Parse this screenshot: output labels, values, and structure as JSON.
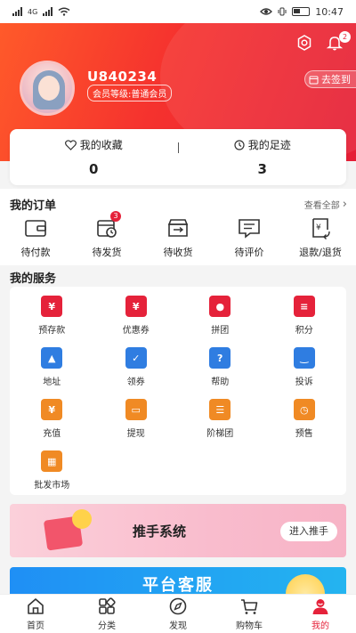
{
  "status_bar": {
    "network": "4G",
    "time": "10:47"
  },
  "header": {
    "username": "U840234",
    "member_level": "会员等级:普通会员",
    "notification_count": "2",
    "signin_label": "去签到"
  },
  "favorites": [
    {
      "label": "我的收藏",
      "count": "0",
      "icon": "heart-icon"
    },
    {
      "label": "我的足迹",
      "count": "3",
      "icon": "clock-icon"
    }
  ],
  "orders": {
    "title": "我的订单",
    "view_all": "查看全部",
    "items": [
      {
        "label": "待付款",
        "icon": "wallet-icon",
        "badge": ""
      },
      {
        "label": "待发货",
        "icon": "pending-ship-icon",
        "badge": "3"
      },
      {
        "label": "待收货",
        "icon": "delivery-box-icon",
        "badge": ""
      },
      {
        "label": "待评价",
        "icon": "comment-icon",
        "badge": ""
      },
      {
        "label": "退款/退货",
        "icon": "refund-icon",
        "badge": ""
      }
    ]
  },
  "services": {
    "title": "我的服务",
    "items": [
      {
        "label": "预存款",
        "icon": "money-bag-icon",
        "color": "#e5223a",
        "glyph": "¥"
      },
      {
        "label": "优惠券",
        "icon": "coupon-icon",
        "color": "#e5223a",
        "glyph": "¥"
      },
      {
        "label": "拼团",
        "icon": "group-icon",
        "color": "#e5223a",
        "glyph": "●"
      },
      {
        "label": "积分",
        "icon": "points-icon",
        "color": "#e5223a",
        "glyph": "≡"
      },
      {
        "label": "地址",
        "icon": "location-icon",
        "color": "#2f7de1",
        "glyph": "▲"
      },
      {
        "label": "领券",
        "icon": "calendar-check-icon",
        "color": "#2f7de1",
        "glyph": "✓"
      },
      {
        "label": "帮助",
        "icon": "help-icon",
        "color": "#2f7de1",
        "glyph": "?"
      },
      {
        "label": "投诉",
        "icon": "complaint-icon",
        "color": "#2f7de1",
        "glyph": "‿"
      },
      {
        "label": "充值",
        "icon": "recharge-icon",
        "color": "#f08a24",
        "glyph": "¥"
      },
      {
        "label": "提现",
        "icon": "withdraw-icon",
        "color": "#f08a24",
        "glyph": "▭"
      },
      {
        "label": "阶梯团",
        "icon": "ladder-group-icon",
        "color": "#f08a24",
        "glyph": "☰"
      },
      {
        "label": "预售",
        "icon": "alarm-clock-icon",
        "color": "#f08a24",
        "glyph": "◷"
      },
      {
        "label": "批发市场",
        "icon": "wholesale-icon",
        "color": "#f08a24",
        "glyph": "▦"
      }
    ]
  },
  "banner_promoter": {
    "title": "推手系统",
    "button": "进入推手"
  },
  "banner_service": {
    "title": "平台客服"
  },
  "tabbar": {
    "items": [
      {
        "label": "首页",
        "icon": "home-icon"
      },
      {
        "label": "分类",
        "icon": "category-icon"
      },
      {
        "label": "发现",
        "icon": "compass-icon"
      },
      {
        "label": "购物车",
        "icon": "cart-icon"
      },
      {
        "label": "我的",
        "icon": "profile-icon"
      }
    ],
    "active_index": 4,
    "accent_color": "#e5223a"
  }
}
